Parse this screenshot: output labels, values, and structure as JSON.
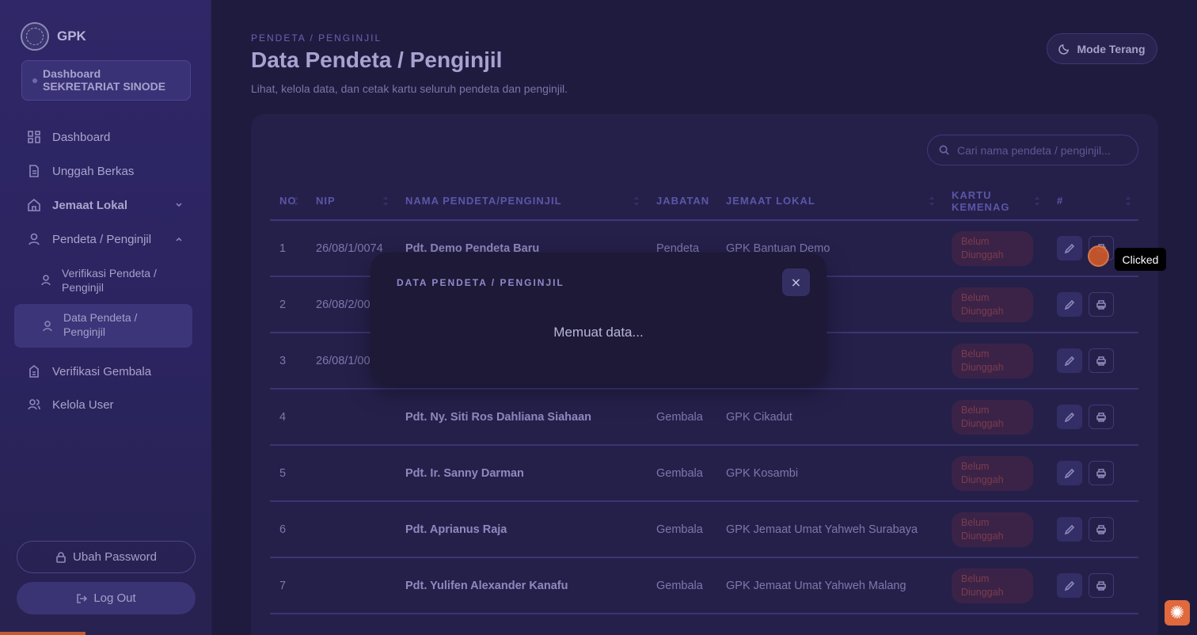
{
  "sidebar": {
    "brand": "GPK",
    "role_line1": "Dashboard",
    "role_line2": "SEKRETARIAT SINODE",
    "nav": [
      {
        "label": "Dashboard"
      },
      {
        "label": "Unggah Berkas"
      },
      {
        "label": "Jemaat Lokal"
      },
      {
        "label": "Pendeta / Penginjil"
      },
      {
        "label": "Verifikasi Gembala"
      },
      {
        "label": "Kelola User"
      }
    ],
    "subnav": [
      {
        "label": "Verifikasi Pendeta / Penginjil"
      },
      {
        "label": "Data Pendeta / Penginjil"
      }
    ],
    "change_password": "Ubah Password",
    "logout": "Log Out"
  },
  "header": {
    "breadcrumb": "PENDETA / PENGINJIL",
    "title": "Data Pendeta / Penginjil",
    "subtitle": "Lihat, kelola data, dan cetak kartu seluruh pendeta dan penginjil.",
    "mode_button": "Mode Terang"
  },
  "search": {
    "placeholder": "Cari nama pendeta / penginjil..."
  },
  "table": {
    "headers": [
      "NO",
      "NIP",
      "NAMA PENDETA/PENGINJIL",
      "JABATAN",
      "JEMAAT LOKAL",
      "KARTU KEMENAG",
      "#"
    ],
    "rows": [
      {
        "no": "1",
        "nip": "26/08/1/0074",
        "nama": "Pdt. Demo Pendeta Baru",
        "jabatan": "Pendeta",
        "jemaat": "GPK Bantuan Demo",
        "kartu": "Belum Diunggah"
      },
      {
        "no": "2",
        "nip": "26/08/2/00",
        "nama": "",
        "jabatan": "",
        "jemaat": "",
        "kartu": "Belum Diunggah"
      },
      {
        "no": "3",
        "nip": "26/08/1/00",
        "nama": "",
        "jabatan": "",
        "jemaat": "",
        "kartu": "Belum Diunggah"
      },
      {
        "no": "4",
        "nip": "",
        "nama": "Pdt. Ny. Siti Ros Dahliana Siahaan",
        "jabatan": "Gembala",
        "jemaat": "GPK Cikadut",
        "kartu": "Belum Diunggah"
      },
      {
        "no": "5",
        "nip": "",
        "nama": "Pdt. Ir. Sanny Darman",
        "jabatan": "Gembala",
        "jemaat": "GPK Kosambi",
        "kartu": "Belum Diunggah"
      },
      {
        "no": "6",
        "nip": "",
        "nama": "Pdt. Aprianus Raja",
        "jabatan": "Gembala",
        "jemaat": "GPK Jemaat Umat Yahweh Surabaya",
        "kartu": "Belum Diunggah"
      },
      {
        "no": "7",
        "nip": "",
        "nama": "Pdt. Yulifen Alexander Kanafu",
        "jabatan": "Gembala",
        "jemaat": "GPK Jemaat Umat Yahweh Malang",
        "kartu": "Belum Diunggah"
      }
    ]
  },
  "modal": {
    "title": "DATA PENDETA / PENGINJIL",
    "close": "×",
    "message": "Memuat data..."
  },
  "tooltip": "Clicked"
}
